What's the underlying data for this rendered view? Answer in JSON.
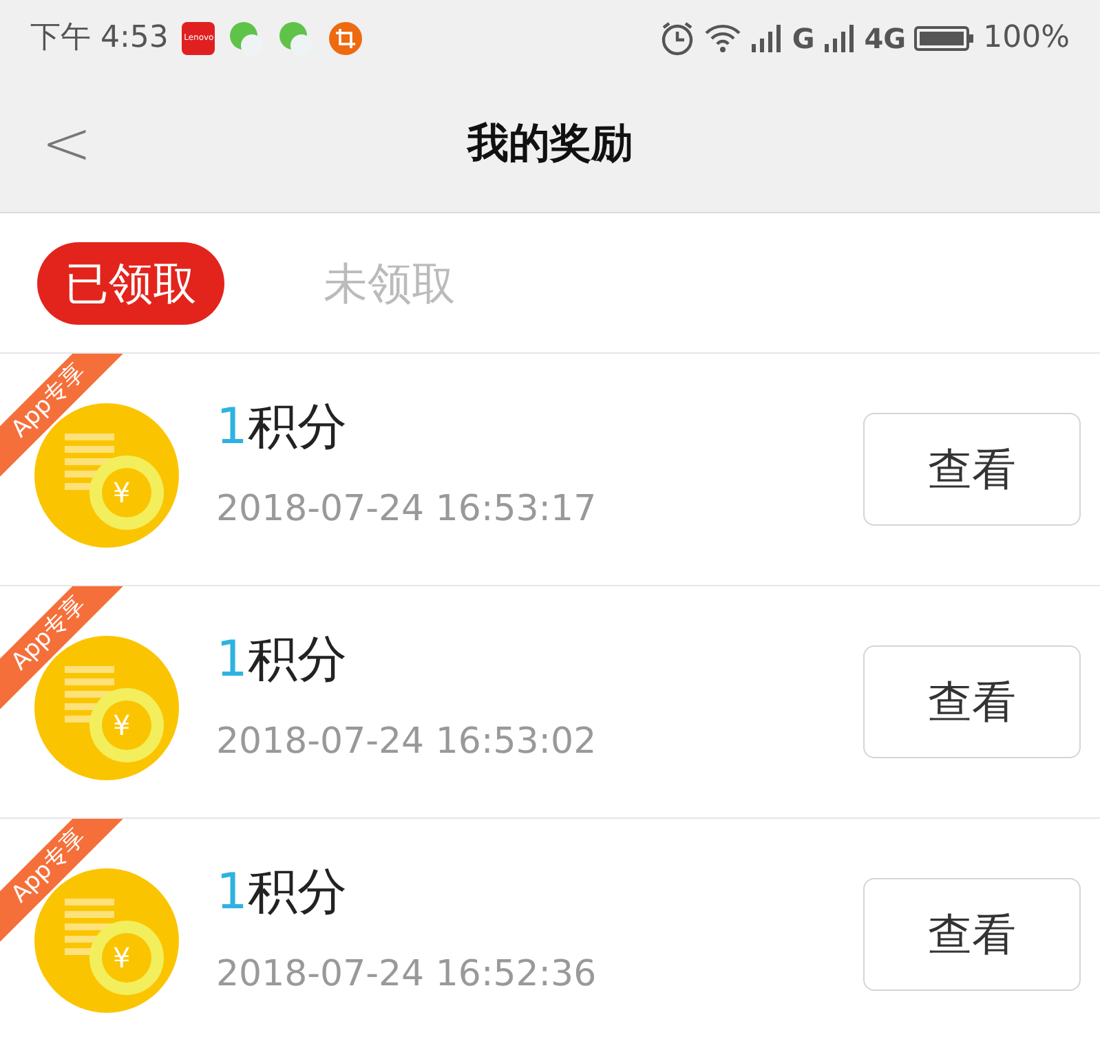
{
  "status_bar": {
    "time": "下午 4:53",
    "app_icon_label": "Lenovo",
    "network_1": "G",
    "network_2": "4G",
    "battery": "100%"
  },
  "header": {
    "back": "<",
    "title": "我的奖励"
  },
  "tabs": [
    {
      "label": "已领取",
      "selected": true
    },
    {
      "label": "未领取",
      "selected": false
    }
  ],
  "rewards": [
    {
      "badge": "App专享",
      "coin_symbol": "¥",
      "amount": "1",
      "unit": "积分",
      "time": "2018-07-24 16:53:17",
      "button": "查看"
    },
    {
      "badge": "App专享",
      "coin_symbol": "¥",
      "amount": "1",
      "unit": "积分",
      "time": "2018-07-24 16:53:02",
      "button": "查看"
    },
    {
      "badge": "App专享",
      "coin_symbol": "¥",
      "amount": "1",
      "unit": "积分",
      "time": "2018-07-24 16:52:36",
      "button": "查看"
    }
  ]
}
